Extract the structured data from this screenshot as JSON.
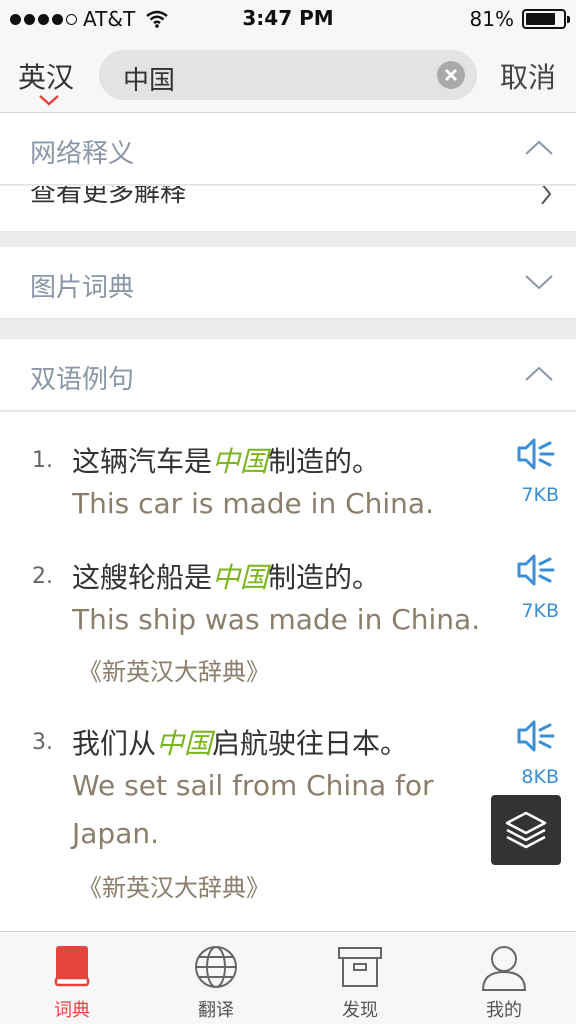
{
  "status_bar": {
    "carrier": "AT&T",
    "time": "3:47 PM",
    "battery": "81%",
    "battery_level": 0.81
  },
  "search": {
    "mode": "英汉",
    "query": "中国",
    "cancel": "取消"
  },
  "sections": {
    "web": {
      "title": "网络释义",
      "more": "查看更多解释"
    },
    "picture": {
      "title": "图片词典"
    },
    "bilingual": {
      "title": "双语例句"
    }
  },
  "examples": [
    {
      "num": "1.",
      "zh_before": "这辆汽车是",
      "zh_hl": "中国",
      "zh_after": "制造的。",
      "en": "This car is made in China.",
      "source": "",
      "size": "7KB"
    },
    {
      "num": "2.",
      "zh_before": "这艘轮船是",
      "zh_hl": "中国",
      "zh_after": "制造的。",
      "en": "This ship was made in China.",
      "source": "《新英汉大辞典》",
      "size": "7KB"
    },
    {
      "num": "3.",
      "zh_before": "我们从",
      "zh_hl": "中国",
      "zh_after": "启航驶往日本。",
      "en": "We set sail from China for Japan.",
      "source": "《新英汉大辞典》",
      "size": "8KB"
    }
  ],
  "tabs": [
    {
      "label": "词典",
      "icon": "dictionary-book-icon",
      "active": true
    },
    {
      "label": "翻译",
      "icon": "globe-icon",
      "active": false
    },
    {
      "label": "发现",
      "icon": "box-icon",
      "active": false
    },
    {
      "label": "我的",
      "icon": "user-icon",
      "active": false
    }
  ],
  "colors": {
    "accent": "#e4443b",
    "highlight": "#7ab51d",
    "link": "#3a8fd6",
    "english_text": "#8b7e6b",
    "section_title": "#8a97a8"
  }
}
